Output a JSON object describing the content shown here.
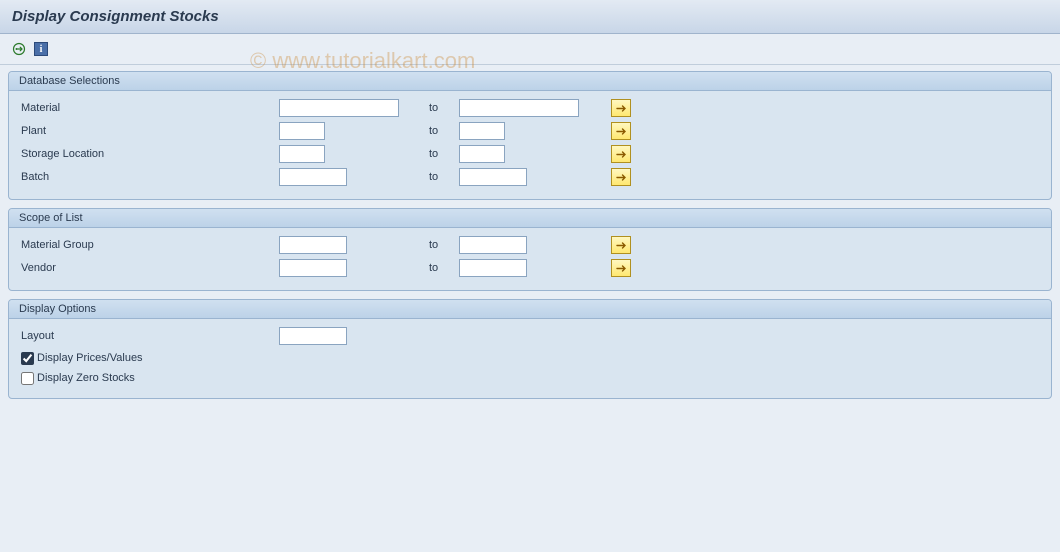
{
  "title": "Display Consignment Stocks",
  "watermark": "© www.tutorialkart.com",
  "groups": {
    "db": {
      "title": "Database Selections",
      "fields": {
        "material": {
          "label": "Material",
          "from": "",
          "to_label": "to",
          "to": ""
        },
        "plant": {
          "label": "Plant",
          "from": "",
          "to_label": "to",
          "to": ""
        },
        "storage_location": {
          "label": "Storage Location",
          "from": "",
          "to_label": "to",
          "to": ""
        },
        "batch": {
          "label": "Batch",
          "from": "",
          "to_label": "to",
          "to": ""
        }
      }
    },
    "scope": {
      "title": "Scope of List",
      "fields": {
        "material_group": {
          "label": "Material Group",
          "from": "",
          "to_label": "to",
          "to": ""
        },
        "vendor": {
          "label": "Vendor",
          "from": "",
          "to_label": "to",
          "to": ""
        }
      }
    },
    "display": {
      "title": "Display Options",
      "layout": {
        "label": "Layout",
        "value": ""
      },
      "prices_values": {
        "label": "Display Prices/Values",
        "checked": true
      },
      "zero_stocks": {
        "label": "Display Zero Stocks",
        "checked": false
      }
    }
  }
}
